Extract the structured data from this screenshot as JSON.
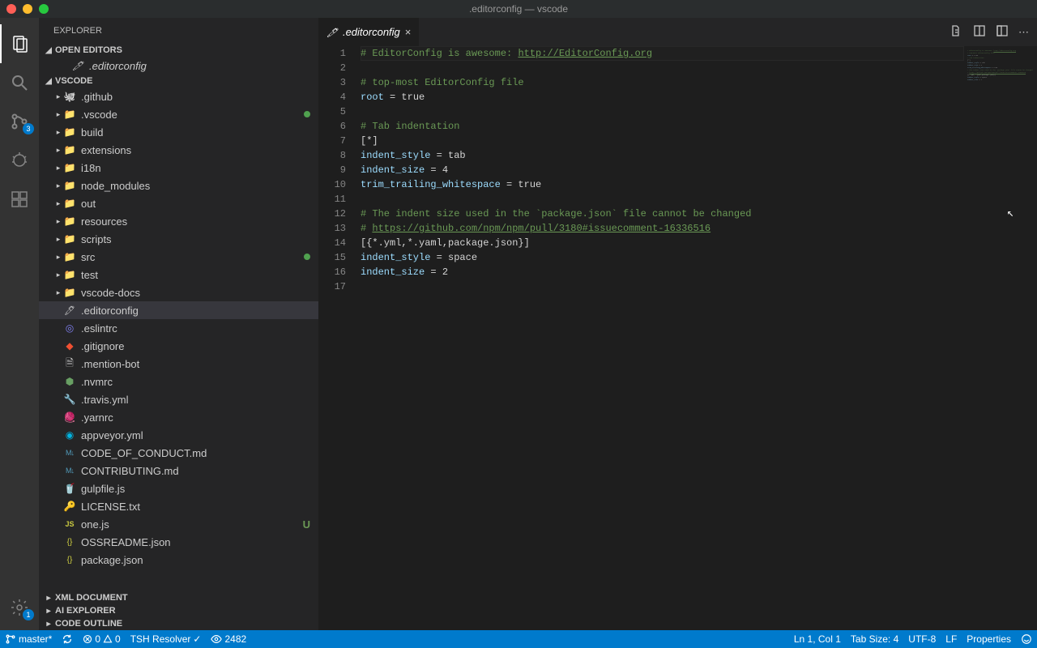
{
  "titlebar": {
    "title": ".editorconfig — vscode"
  },
  "activitybar": {
    "scm_badge": "3",
    "settings_badge": "1"
  },
  "sidebar": {
    "title": "EXPLORER",
    "sections": {
      "open_editors": "OPEN EDITORS",
      "workspace": "VSCODE",
      "xml": "XML DOCUMENT",
      "ai": "AI EXPLORER",
      "outline": "CODE OUTLINE"
    },
    "open_editor_item": ".editorconfig",
    "tree": [
      {
        "type": "folder",
        "label": ".github",
        "icon": "ico-gh",
        "depth": 1
      },
      {
        "type": "folder",
        "label": ".vscode",
        "icon": "ico-vscode",
        "depth": 1,
        "modified": true
      },
      {
        "type": "folder",
        "label": "build",
        "icon": "ico-folder",
        "depth": 1
      },
      {
        "type": "folder",
        "label": "extensions",
        "icon": "ico-folder",
        "depth": 1
      },
      {
        "type": "folder",
        "label": "i18n",
        "icon": "ico-i18n",
        "depth": 1
      },
      {
        "type": "folder",
        "label": "node_modules",
        "icon": "ico-nm",
        "depth": 1
      },
      {
        "type": "folder",
        "label": "out",
        "icon": "ico-folder",
        "depth": 1
      },
      {
        "type": "folder",
        "label": "resources",
        "icon": "ico-folder",
        "depth": 1
      },
      {
        "type": "folder",
        "label": "scripts",
        "icon": "ico-folder",
        "depth": 1
      },
      {
        "type": "folder",
        "label": "src",
        "icon": "ico-src",
        "depth": 1,
        "modified": true
      },
      {
        "type": "folder",
        "label": "test",
        "icon": "ico-test",
        "depth": 1
      },
      {
        "type": "folder",
        "label": "vscode-docs",
        "icon": "ico-folder",
        "depth": 1
      },
      {
        "type": "file",
        "label": ".editorconfig",
        "icon": "ico-editorconfig",
        "depth": 1,
        "selected": true
      },
      {
        "type": "file",
        "label": ".eslintrc",
        "icon": "ico-eslint",
        "depth": 1
      },
      {
        "type": "file",
        "label": ".gitignore",
        "icon": "ico-git",
        "depth": 1
      },
      {
        "type": "file",
        "label": ".mention-bot",
        "icon": "ico-file",
        "depth": 1
      },
      {
        "type": "file",
        "label": ".nvmrc",
        "icon": "ico-nvm",
        "depth": 1
      },
      {
        "type": "file",
        "label": ".travis.yml",
        "icon": "ico-travis",
        "depth": 1
      },
      {
        "type": "file",
        "label": ".yarnrc",
        "icon": "ico-yarn",
        "depth": 1
      },
      {
        "type": "file",
        "label": "appveyor.yml",
        "icon": "ico-appveyor",
        "depth": 1
      },
      {
        "type": "file",
        "label": "CODE_OF_CONDUCT.md",
        "icon": "ico-md",
        "depth": 1
      },
      {
        "type": "file",
        "label": "CONTRIBUTING.md",
        "icon": "ico-md",
        "depth": 1
      },
      {
        "type": "file",
        "label": "gulpfile.js",
        "icon": "ico-gulp",
        "depth": 1
      },
      {
        "type": "file",
        "label": "LICENSE.txt",
        "icon": "ico-license",
        "depth": 1
      },
      {
        "type": "file",
        "label": "one.js",
        "icon": "ico-js",
        "depth": 1,
        "status": "U"
      },
      {
        "type": "file",
        "label": "OSSREADME.json",
        "icon": "ico-json",
        "depth": 1
      },
      {
        "type": "file",
        "label": "package.json",
        "icon": "ico-json",
        "depth": 1
      }
    ]
  },
  "tab": {
    "label": ".editorconfig"
  },
  "editor": {
    "lines": [
      {
        "n": 1,
        "html": "<span class='c-comment'># EditorConfig is awesome: </span><span class='c-link'>http://EditorConfig.org</span>"
      },
      {
        "n": 2,
        "html": ""
      },
      {
        "n": 3,
        "html": "<span class='c-comment'># top-most EditorConfig file</span>"
      },
      {
        "n": 4,
        "html": "<span class='c-key'>root</span><span class='c-op'> = true</span>"
      },
      {
        "n": 5,
        "html": ""
      },
      {
        "n": 6,
        "html": "<span class='c-comment'># Tab indentation</span>"
      },
      {
        "n": 7,
        "html": "<span class='c-section'>[*]</span>"
      },
      {
        "n": 8,
        "html": "<span class='c-key'>indent_style</span><span class='c-op'> = tab</span>"
      },
      {
        "n": 9,
        "html": "<span class='c-key'>indent_size</span><span class='c-op'> = 4</span>"
      },
      {
        "n": 10,
        "html": "<span class='c-key'>trim_trailing_whitespace</span><span class='c-op'> = true</span>"
      },
      {
        "n": 11,
        "html": ""
      },
      {
        "n": 12,
        "html": "<span class='c-comment'># The indent size used in the `package.json` file cannot be changed</span>"
      },
      {
        "n": 13,
        "html": "<span class='c-comment'># </span><span class='c-link'>https://github.com/npm/npm/pull/3180#issuecomment-16336516</span>"
      },
      {
        "n": 14,
        "html": "<span class='c-section'>[{*.yml,*.yaml,package.json}]</span>"
      },
      {
        "n": 15,
        "html": "<span class='c-key'>indent_style</span><span class='c-op'> = space</span>"
      },
      {
        "n": 16,
        "html": "<span class='c-key'>indent_size</span><span class='c-op'> = 2</span>"
      },
      {
        "n": 17,
        "html": ""
      }
    ]
  },
  "statusbar": {
    "branch": "master*",
    "errors": "0",
    "warnings": "0",
    "tsh": "TSH Resolver",
    "eye": "2482",
    "lncol": "Ln 1, Col 1",
    "tabsize": "Tab Size: 4",
    "encoding": "UTF-8",
    "eol": "LF",
    "lang": "Properties"
  }
}
